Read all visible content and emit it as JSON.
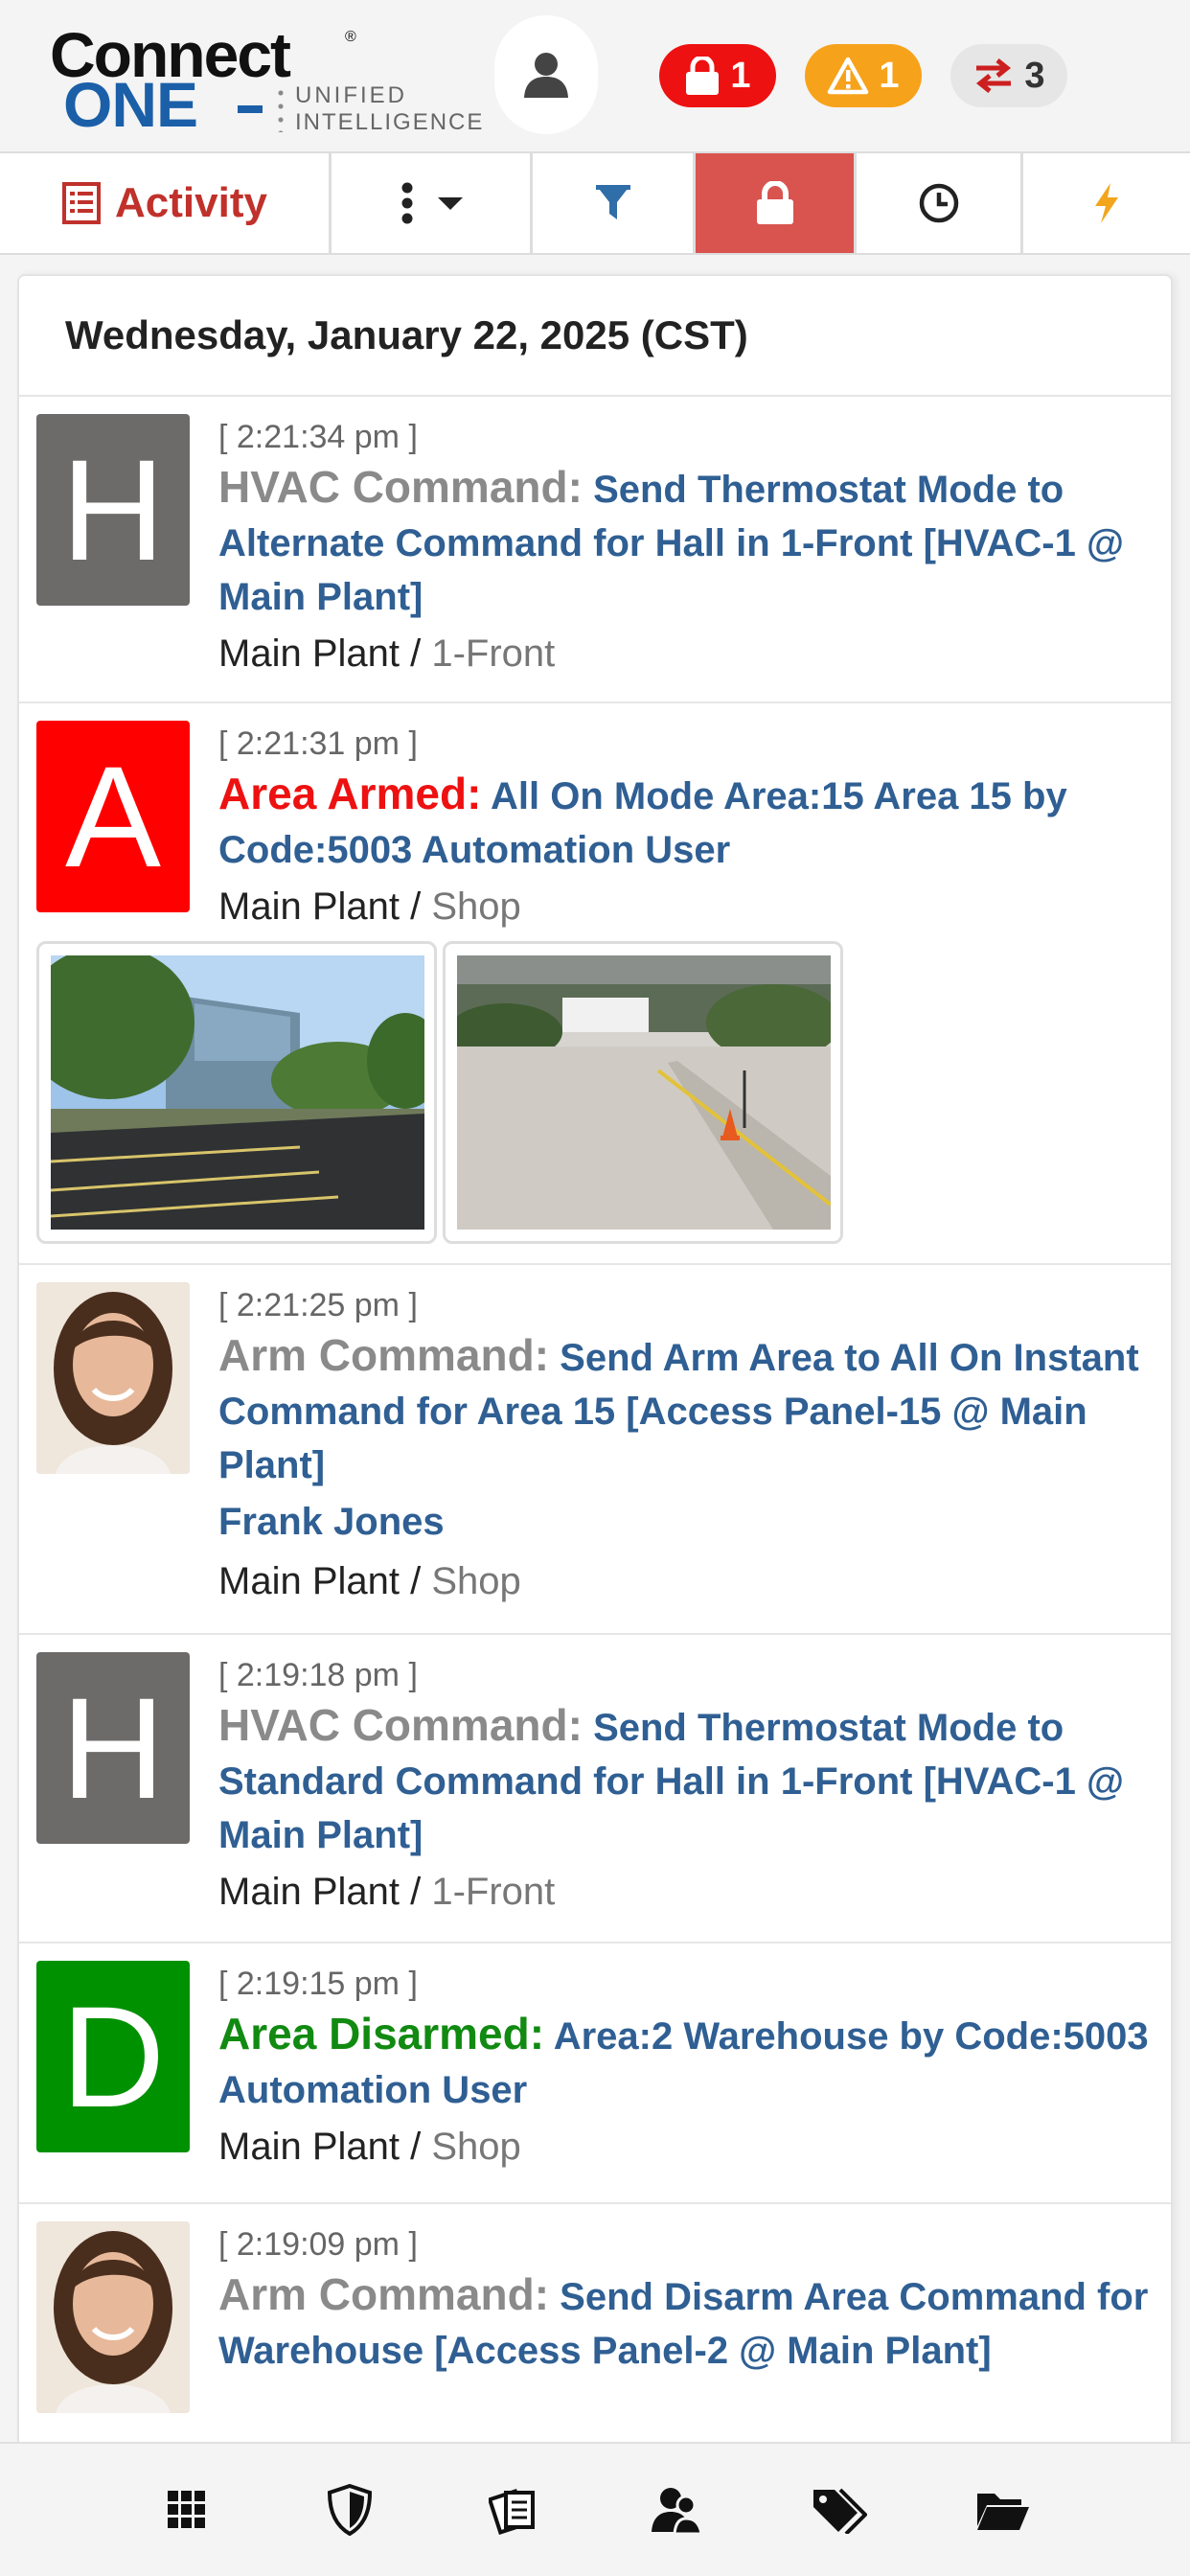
{
  "header": {
    "logo": {
      "word1": "Connect",
      "word2": "ONE",
      "tag1": "UNIFIED",
      "tag2": "INTELLIGENCE",
      "reg": "®"
    },
    "badges": [
      {
        "icon": "lock-icon",
        "count": "1",
        "color": "#ee1111"
      },
      {
        "icon": "warning-icon",
        "count": "1",
        "color": "#f7a21b"
      },
      {
        "icon": "transfer-arrows-icon",
        "count": "3",
        "color": "#e6e6e6"
      }
    ]
  },
  "toolbar": {
    "activity_label": "Activity",
    "accent": "#c0312b",
    "active_tab_color": "#d9534f"
  },
  "feed": {
    "date": "Wednesday, January 22, 2025 (CST)",
    "entries": [
      {
        "time": "[ 2:21:34 pm ]",
        "letter": "H",
        "category": "HVAC Command:",
        "description": "Send Thermostat Mode to Alternate Command for Hall in 1-Front [HVAC-1 @ Main Plant]",
        "site": "Main Plant /",
        "area": "1-Front"
      },
      {
        "time": "[ 2:21:31 pm ]",
        "letter": "A",
        "category": "Area Armed:",
        "description": "All On Mode Area:15 Area 15 by Code:5003 Automation User",
        "site": "Main Plant /",
        "area": "Shop"
      },
      {
        "time": "[ 2:21:25 pm ]",
        "category": "Arm Command:",
        "description": "Send Arm Area to All On Instant Command for Area 15 [Access Panel-15 @ Main Plant]",
        "user": "Frank Jones",
        "site": "Main Plant /",
        "area": "Shop"
      },
      {
        "time": "[ 2:19:18 pm ]",
        "letter": "H",
        "category": "HVAC Command:",
        "description": "Send Thermostat Mode to Standard Command for Hall in 1-Front [HVAC-1 @ Main Plant]",
        "site": "Main Plant /",
        "area": "1-Front"
      },
      {
        "time": "[ 2:19:15 pm ]",
        "letter": "D",
        "category": "Area Disarmed:",
        "description": "Area:2 Warehouse by Code:5003 Automation User",
        "site": "Main Plant /",
        "area": "Shop"
      },
      {
        "time": "[ 2:19:09 pm ]",
        "category": "Arm Command:",
        "description": "Send Disarm Area Command for Warehouse [Access Panel-2 @ Main Plant]"
      }
    ]
  },
  "bottom_nav": [
    "grid-icon",
    "shield-icon",
    "reports-icon",
    "users-icon",
    "tags-icon",
    "folder-icon"
  ]
}
